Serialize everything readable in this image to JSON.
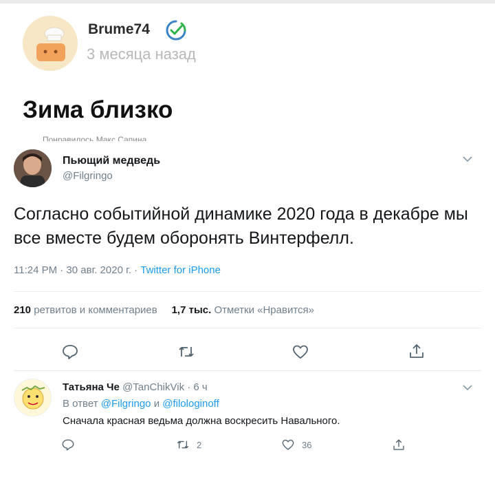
{
  "post": {
    "author": "Brume74",
    "time": "3 месяца назад",
    "title": "Зима близко"
  },
  "tweet": {
    "cut_label": "Понравилось Макс Сапина",
    "name": "Пьющий медведь",
    "handle": "@Filgringo",
    "text": "Согласно событийной динамике 2020 года в декабре мы все вместе будем оборонять Винтерфелл.",
    "time": "11:24 PM · 30 авг. 2020 г. · ",
    "source": "Twitter for iPhone",
    "retweets_count": "210",
    "retweets_label": "ретвитов и комментариев",
    "likes_count": "1,7 тыс.",
    "likes_label": "Отметки «Нравится»"
  },
  "reply": {
    "name": "Татьяна Че",
    "handle_time": "@TanChikVik · 6 ч",
    "reply_prefix": "В ответ",
    "mention1": "@Filgringo",
    "and": "и",
    "mention2": "@filologinoff",
    "text": "Сначала красная ведьма должна воскресить Навального.",
    "retweets": "2",
    "likes": "36"
  },
  "colors": {
    "accent": "#1d9bf0",
    "verified": "#2db34a",
    "muted": "#6f7f8c"
  }
}
